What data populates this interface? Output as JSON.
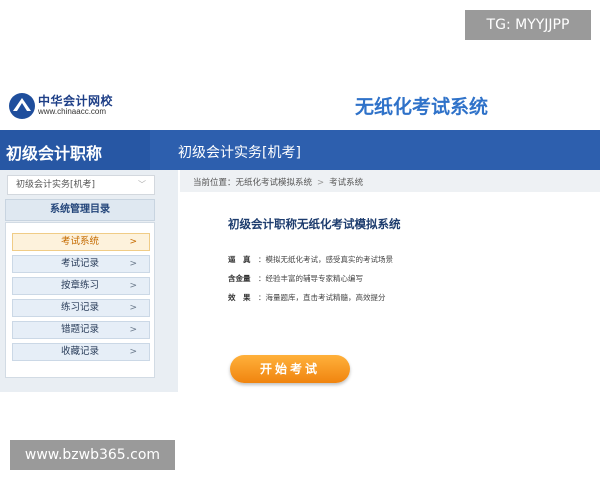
{
  "watermarks": {
    "top": "TG: MYYJJPP",
    "bottom": "www.bzwb365.com"
  },
  "header": {
    "logo_cn": "中华会计网校",
    "logo_en": "www.chinaacc.com",
    "system_title": "无纸化考试系统"
  },
  "topbar": {
    "category": "初级会计职称",
    "course": "初级会计实务[机考]"
  },
  "sidebar": {
    "course_select": "初级会计实务[机考]",
    "menu_title": "系统管理目录",
    "items": [
      {
        "label": "考试系统",
        "active": true
      },
      {
        "label": "考试记录",
        "active": false
      },
      {
        "label": "按章练习",
        "active": false
      },
      {
        "label": "练习记录",
        "active": false
      },
      {
        "label": "错题记录",
        "active": false
      },
      {
        "label": "收藏记录",
        "active": false
      }
    ]
  },
  "breadcrumb": {
    "prefix": "当前位置：",
    "level1": "无纸化考试模拟系统",
    "separator": ">",
    "level2": "考试系统"
  },
  "main": {
    "title": "初级会计职称无纸化考试模拟系统",
    "features": [
      {
        "key": "逼　真",
        "value": "：模拟无纸化考试，感受真实的考试场景"
      },
      {
        "key": "含金量",
        "value": "：经验丰富的辅导专家精心编写"
      },
      {
        "key": "效　果",
        "value": "：海量题库，直击考试精髓，高效提分"
      }
    ],
    "start_button": "开始考试"
  },
  "colors": {
    "brand_blue": "#2d5fae",
    "title_blue": "#2f72c9",
    "active_orange": "#c56b00",
    "button_orange": "#f0840f"
  }
}
